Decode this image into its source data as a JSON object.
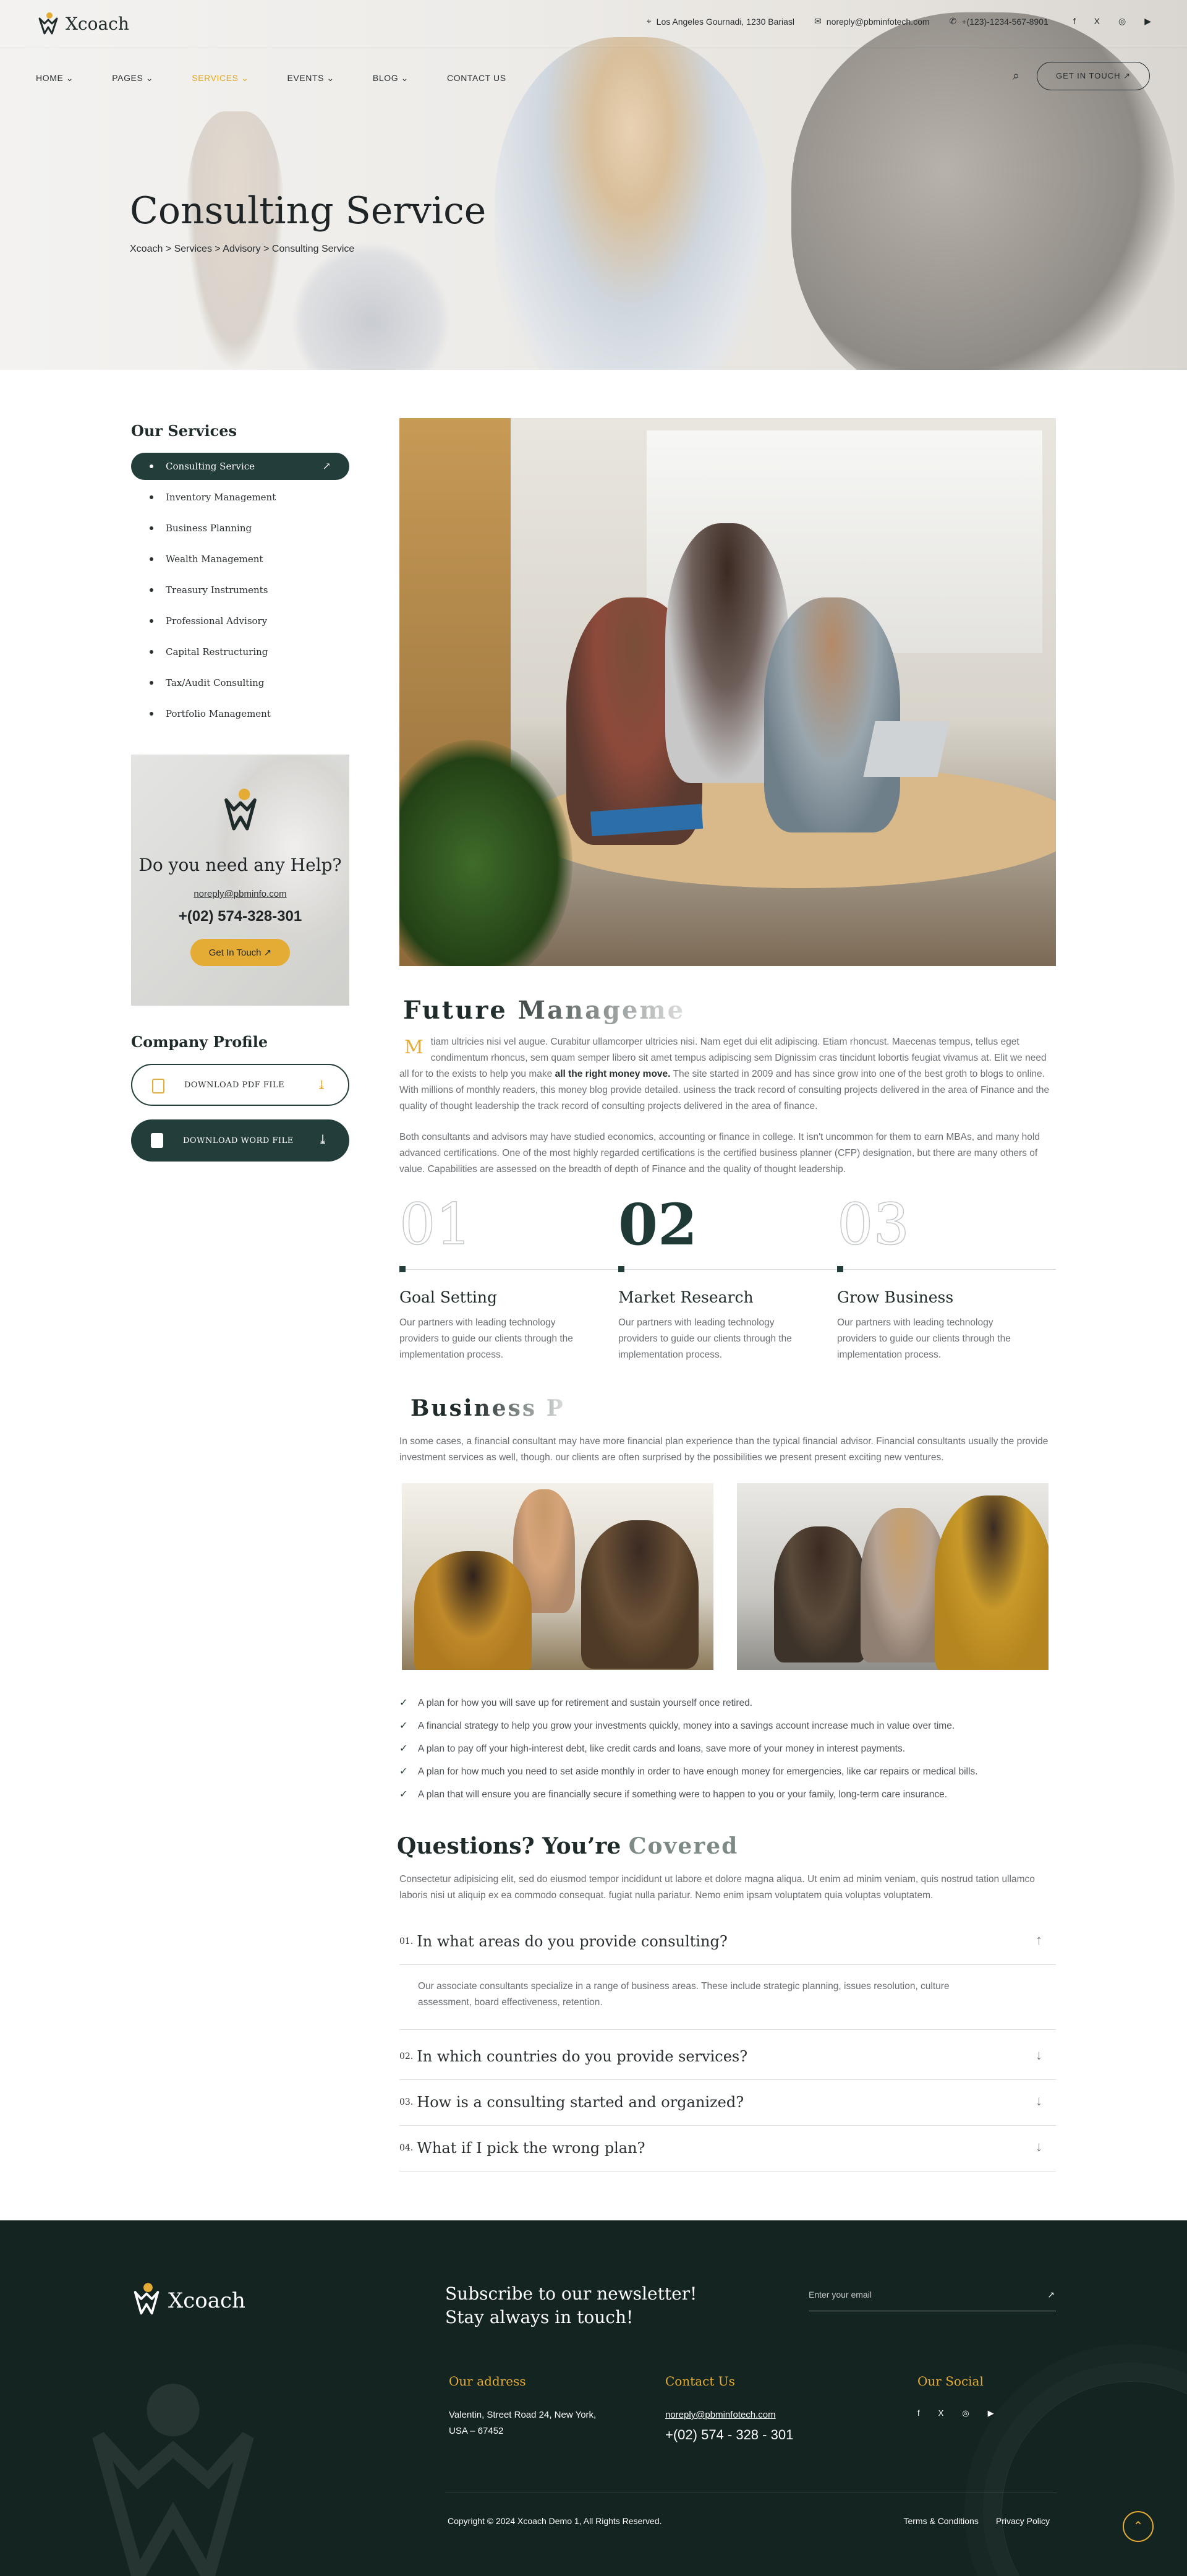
{
  "brand": {
    "name": "Xcoach"
  },
  "topbar": {
    "address": "Los Angeles Gournadi, 1230 Bariasl",
    "email": "noreply@pbminfotech.com",
    "phone": "+(123)-1234-567-8901",
    "social": [
      "f",
      "X",
      "◎",
      "▶"
    ]
  },
  "nav": {
    "items": [
      {
        "label": "HOME ⌄"
      },
      {
        "label": "PAGES ⌄"
      },
      {
        "label": "SERVICES ⌄"
      },
      {
        "label": "EVENTS ⌄"
      },
      {
        "label": "BLOG ⌄"
      },
      {
        "label": "CONTACT US"
      }
    ],
    "active_index": 2,
    "cta": "GET IN TOUCH ↗"
  },
  "hero": {
    "title": "Consulting Service",
    "breadcrumb": "Xcoach > Services > Advisory > Consulting Service"
  },
  "sidebar": {
    "heading": "Our Services",
    "services": [
      "Consulting Service",
      "Inventory Management",
      "Business Planning",
      "Wealth Management",
      "Treasury Instruments",
      "Professional Advisory",
      "Capital Restructuring",
      "Tax/Audit Consulting",
      "Portfolio Management"
    ],
    "help": {
      "title": "Do you need any Help?",
      "email": "noreply@pbminfo.com",
      "phone": "+(02) 574-328-301",
      "button": "Get In Touch ↗"
    },
    "profile": {
      "heading": "Company Profile",
      "pdf": "DOWNLOAD PDF FILE",
      "word": "DOWNLOAD WORD FILE"
    }
  },
  "main": {
    "future_title": "Future Manageme",
    "dropcap": "M",
    "para1_a": "tiam ultricies nisi vel augue. Curabitur ullamcorper ultricies nisi. Nam eget dui elit adipiscing. Etiam rhoncust. Maecenas tempus, tellus eget condimentum rhoncus, sem quam semper libero sit amet tempus adipiscing sem Dignissim cras tincidunt lobortis feugiat vivamus at. Elit we need all for to the exists to help you make ",
    "para1_b": "all the right money move.",
    "para1_c": " The site started in 2009 and has since grow into one of the best groth to blogs to online. With millions of monthly readers, this money blog provide detailed. usiness the track record of consulting projects delivered in the area of Finance and the quality of thought leadership the track record of consulting projects delivered in the area of finance.",
    "para2": "Both consultants and advisors may have studied economics, accounting or finance in college. It isn't uncommon for them to earn MBAs, and many hold advanced certifications. One of the most highly regarded certifications is the certified business planner (CFP) designation, but there are many others of value. Capabilities are assessed on the breadth of depth of Finance and the quality of thought leadership.",
    "steps": [
      {
        "num": "01",
        "title": "Goal Setting",
        "text": "Our partners with leading technology providers to guide our clients through the implementation process."
      },
      {
        "num": "02",
        "title": "Market Research",
        "text": "Our partners with leading technology providers to guide our clients through the implementation process."
      },
      {
        "num": "03",
        "title": "Grow Business",
        "text": "Our partners with leading technology providers to guide our clients through the implementation process."
      }
    ],
    "business_title": "Business P",
    "business_text": "In some cases, a financial consultant may have more financial plan experience than the typical financial advisor. Financial consultants usually the provide investment services as well, though. our clients are often surprised by the possibilities we present present exciting new ventures.",
    "checklist": [
      "A plan for how you will save up for retirement and sustain yourself once retired.",
      "A financial strategy to help you grow your investments quickly, money into a savings account increase much in value over time.",
      "A plan to pay off your high-interest debt, like credit cards and loans, save more of your money in interest payments.",
      "A plan for how much you need to set aside monthly in order to have enough money for emergencies, like car repairs or medical bills.",
      "A plan that will ensure you are financially secure if something were to happen to you or your family, long-term care insurance."
    ],
    "faq_title_a": "Questions? You’re ",
    "faq_title_b": "Covered",
    "faq_intro": "Consectetur adipisicing elit, sed do eiusmod tempor incididunt ut labore et dolore magna aliqua. Ut enim ad minim veniam, quis nostrud tation ullamco laboris nisi ut aliquip ex ea commodo consequat. fugiat nulla pariatur. Nemo enim ipsam voluptatem quia voluptas voluptatem.",
    "faqs": [
      {
        "num": "01.",
        "q": "In what areas do you provide consulting?",
        "a": "Our associate consultants specialize in a range of business areas. These include strategic planning, issues resolution, culture assessment, board effectiveness, retention.",
        "icon": "↑"
      },
      {
        "num": "02.",
        "q": "In which countries do you provide services?",
        "icon": "↓"
      },
      {
        "num": "03.",
        "q": "How is a consulting started and organized?",
        "icon": "↓"
      },
      {
        "num": "04.",
        "q": "What if I pick the wrong plan?",
        "icon": "↓"
      }
    ]
  },
  "footer": {
    "newsletter": "Subscribe to our newsletter! Stay always in touch!",
    "email_placeholder": "Enter your email",
    "address_title": "Our address",
    "address": "Valentin, Street Road 24, New York, USA – 67452",
    "contact_title": "Contact Us",
    "contact_email": "noreply@pbminfotech.com",
    "contact_phone": "+(02) 574 - 328 - 301",
    "social_title": "Our Social",
    "social": [
      "f",
      "X",
      "◎",
      "▶"
    ],
    "copyright": "Copyright © 2024 Xcoach Demo 1, All Rights Reserved.",
    "links": [
      "Terms & Conditions",
      "Privacy Policy"
    ]
  },
  "colors": {
    "accent": "#e5ac35",
    "dark_green": "#233d3a",
    "footer_bg": "#142420"
  }
}
